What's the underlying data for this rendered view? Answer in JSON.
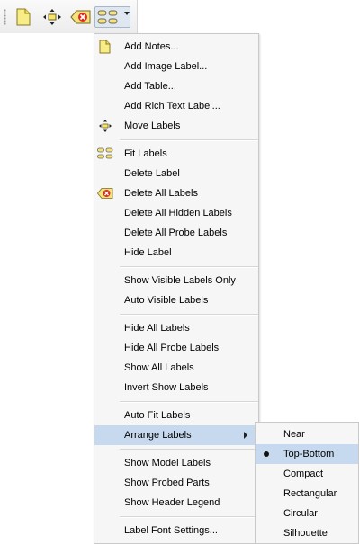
{
  "toolbar": {
    "buttons": [
      {
        "icon": "notes-icon"
      },
      {
        "icon": "move-labels-icon"
      },
      {
        "icon": "delete-all-labels-icon"
      },
      {
        "icon": "fit-labels-icon"
      }
    ]
  },
  "menu": {
    "items": [
      {
        "label": "Add Notes..."
      },
      {
        "label": "Add Image Label..."
      },
      {
        "label": "Add Table..."
      },
      {
        "label": "Add Rich Text Label..."
      },
      {
        "label": "Move Labels"
      },
      {
        "label": "Fit Labels"
      },
      {
        "label": "Delete Label"
      },
      {
        "label": "Delete All Labels"
      },
      {
        "label": "Delete All Hidden Labels"
      },
      {
        "label": "Delete All Probe Labels"
      },
      {
        "label": "Hide Label"
      },
      {
        "label": "Show Visible Labels Only"
      },
      {
        "label": "Auto Visible Labels"
      },
      {
        "label": "Hide All Labels"
      },
      {
        "label": "Hide All Probe Labels"
      },
      {
        "label": "Show All Labels"
      },
      {
        "label": "Invert Show Labels"
      },
      {
        "label": "Auto Fit Labels"
      },
      {
        "label": "Arrange Labels"
      },
      {
        "label": "Show Model Labels"
      },
      {
        "label": "Show Probed Parts"
      },
      {
        "label": "Show Header Legend"
      },
      {
        "label": "Label Font Settings..."
      }
    ]
  },
  "submenu": {
    "items": [
      {
        "label": "Near"
      },
      {
        "label": "Top-Bottom",
        "selected": true
      },
      {
        "label": "Compact"
      },
      {
        "label": "Rectangular"
      },
      {
        "label": "Circular"
      },
      {
        "label": "Silhouette"
      }
    ]
  },
  "colors": {
    "highlight": "#c7d9ef",
    "menu_bg": "#f6f6f6",
    "icon_yellow": "#f3e56a",
    "icon_red": "#d9261c"
  }
}
